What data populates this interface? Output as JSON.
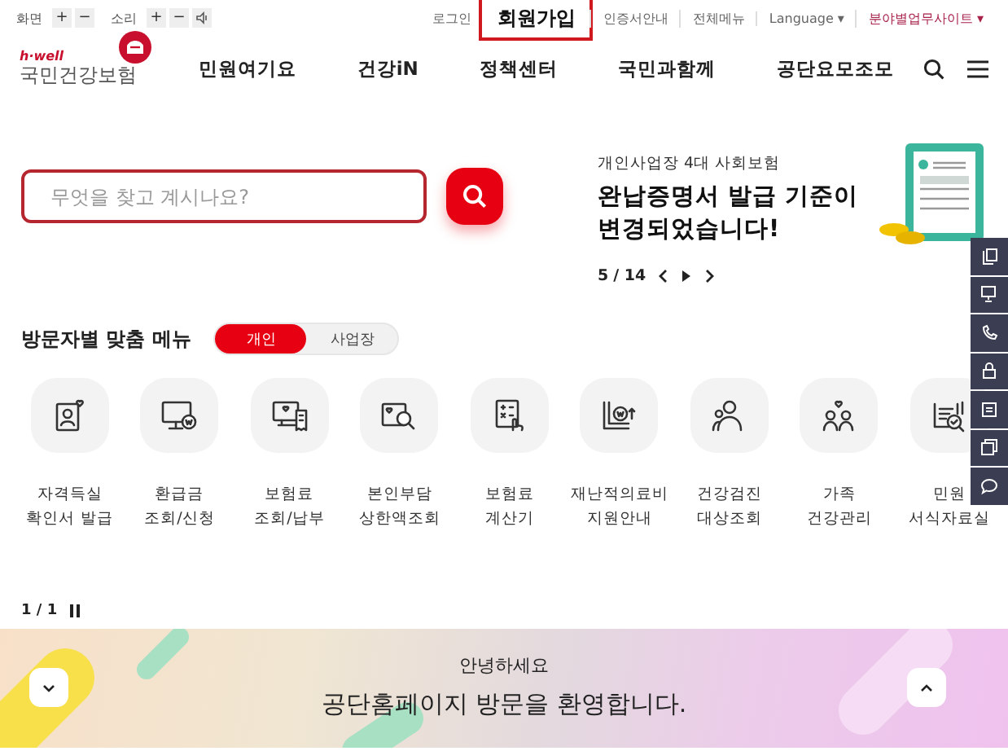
{
  "utility": {
    "screen_label": "화면",
    "sound_label": "소리",
    "zoom_in": "+",
    "zoom_out": "−",
    "volume_up": "+",
    "volume_down": "−",
    "links": [
      {
        "label": "로그인",
        "highlighted": false
      },
      {
        "label": "회원가입",
        "highlighted": true
      },
      {
        "label": "인증서안내",
        "highlighted": false
      },
      {
        "label": "전체메뉴",
        "highlighted": false
      },
      {
        "label": "Language ▾",
        "highlighted": false
      },
      {
        "label": "분야별업무사이트 ▾",
        "highlighted": false
      }
    ]
  },
  "logo": {
    "tagline": "h·well",
    "name": "국민건강보험"
  },
  "nav": [
    "민원여기요",
    "건강iN",
    "정책센터",
    "국민과함께",
    "공단요모조모"
  ],
  "search": {
    "placeholder": "무엇을 찾고 계시나요?"
  },
  "promo": {
    "eyebrow": "개인사업장 4대 사회보험",
    "title": "완납증명서 발급 기준이 변경되었습니다!",
    "current": "5",
    "total": "/ 14"
  },
  "visitor_menu": {
    "title": "방문자별 맞춤 메뉴",
    "tabs": [
      {
        "label": "개인",
        "selected": true
      },
      {
        "label": "사업장",
        "selected": false
      }
    ]
  },
  "quick_menu": [
    {
      "kind": "person-card",
      "lines": [
        "자격득실",
        "확인서 발급"
      ]
    },
    {
      "kind": "monitor",
      "lines": [
        "환급금",
        "조회/신청"
      ]
    },
    {
      "kind": "receipt",
      "lines": [
        "보험료",
        "조회/납부"
      ]
    },
    {
      "kind": "search-doc",
      "lines": [
        "본인부담",
        "상한액조회"
      ]
    },
    {
      "kind": "calculator",
      "lines": [
        "보험료",
        "계산기"
      ]
    },
    {
      "kind": "won-chart",
      "lines": [
        "재난적의료비",
        "지원안내"
      ]
    },
    {
      "kind": "people",
      "lines": [
        "건강검진",
        "대상조회"
      ]
    },
    {
      "kind": "family",
      "lines": [
        "가족",
        "건강관리"
      ]
    },
    {
      "kind": "doc-check",
      "lines": [
        "민원",
        "서식자료실"
      ]
    }
  ],
  "quick_pager": "1 / 1",
  "banner": {
    "greeting": "안녕하세요",
    "message": "공단홈페이지 방문을 환영합니다."
  }
}
